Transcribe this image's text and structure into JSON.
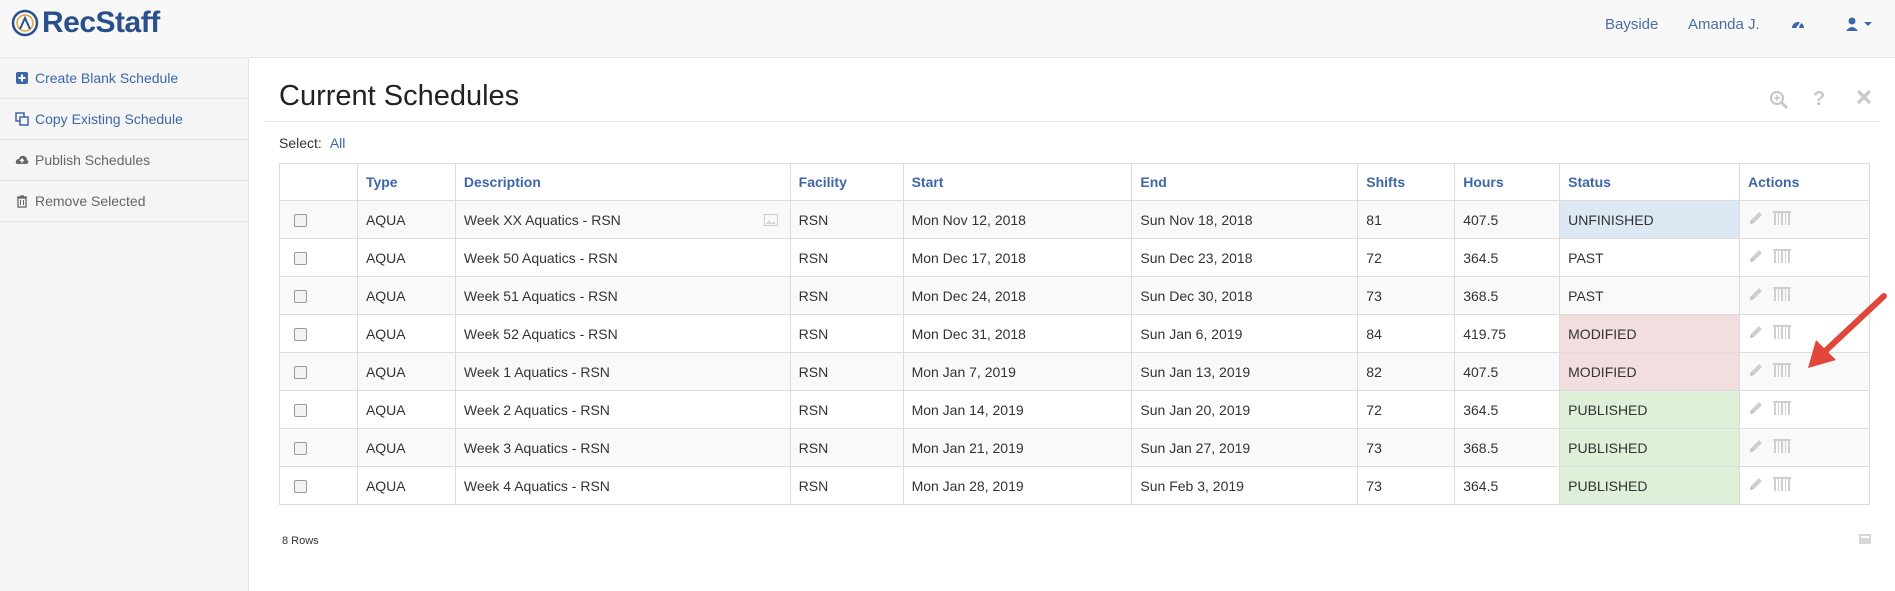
{
  "app": {
    "logo_text": "RecStaff",
    "brand_color": "#2a4f8d",
    "link_color": "#3d67a8"
  },
  "topnav": {
    "facility": "Bayside",
    "user": "Amanda J.",
    "dashboard_icon": "dashboard-icon",
    "profile_icon": "user-icon"
  },
  "sidebar": {
    "items": [
      {
        "label": "Create Blank Schedule",
        "icon": "plus-square-icon"
      },
      {
        "label": "Copy Existing Schedule",
        "icon": "copy-icon"
      },
      {
        "label": "Publish Schedules",
        "icon": "cloud-upload-icon"
      },
      {
        "label": "Remove Selected",
        "icon": "trash-icon"
      }
    ]
  },
  "main": {
    "title": "Current Schedules",
    "select_label": "Select:",
    "select_all": "All",
    "rows_count": "8 Rows"
  },
  "table": {
    "headers": [
      "Type",
      "Description",
      "Facility",
      "Start",
      "End",
      "Shifts",
      "Hours",
      "Status",
      "Actions"
    ],
    "rows": [
      {
        "type": "AQUA",
        "description": "Week XX Aquatics - RSN",
        "facility": "RSN",
        "start": "Mon Nov 12, 2018",
        "end": "Sun Nov 18, 2018",
        "shifts": "81",
        "hours": "407.5",
        "status": "UNFINISHED",
        "status_color": "#dce9f5"
      },
      {
        "type": "AQUA",
        "description": "Week 50 Aquatics - RSN",
        "facility": "RSN",
        "start": "Mon Dec 17, 2018",
        "end": "Sun Dec 23, 2018",
        "shifts": "72",
        "hours": "364.5",
        "status": "PAST",
        "status_color": ""
      },
      {
        "type": "AQUA",
        "description": "Week 51 Aquatics - RSN",
        "facility": "RSN",
        "start": "Mon Dec 24, 2018",
        "end": "Sun Dec 30, 2018",
        "shifts": "73",
        "hours": "368.5",
        "status": "PAST",
        "status_color": ""
      },
      {
        "type": "AQUA",
        "description": "Week 52 Aquatics - RSN",
        "facility": "RSN",
        "start": "Mon Dec 31, 2018",
        "end": "Sun Jan 6, 2019",
        "shifts": "84",
        "hours": "419.75",
        "status": "MODIFIED",
        "status_color": "#f2dede"
      },
      {
        "type": "AQUA",
        "description": "Week 1 Aquatics - RSN",
        "facility": "RSN",
        "start": "Mon Jan 7, 2019",
        "end": "Sun Jan 13, 2019",
        "shifts": "82",
        "hours": "407.5",
        "status": "MODIFIED",
        "status_color": "#f2dede"
      },
      {
        "type": "AQUA",
        "description": "Week 2 Aquatics - RSN",
        "facility": "RSN",
        "start": "Mon Jan 14, 2019",
        "end": "Sun Jan 20, 2019",
        "shifts": "72",
        "hours": "364.5",
        "status": "PUBLISHED",
        "status_color": "#dff0d8"
      },
      {
        "type": "AQUA",
        "description": "Week 3 Aquatics - RSN",
        "facility": "RSN",
        "start": "Mon Jan 21, 2019",
        "end": "Sun Jan 27, 2019",
        "shifts": "73",
        "hours": "368.5",
        "status": "PUBLISHED",
        "status_color": "#dff0d8"
      },
      {
        "type": "AQUA",
        "description": "Week 4 Aquatics - RSN",
        "facility": "RSN",
        "start": "Mon Jan 28, 2019",
        "end": "Sun Feb 3, 2019",
        "shifts": "73",
        "hours": "364.5",
        "status": "PUBLISHED",
        "status_color": "#dff0d8"
      }
    ]
  },
  "annotation": {
    "arrow_color": "#e0473a"
  }
}
